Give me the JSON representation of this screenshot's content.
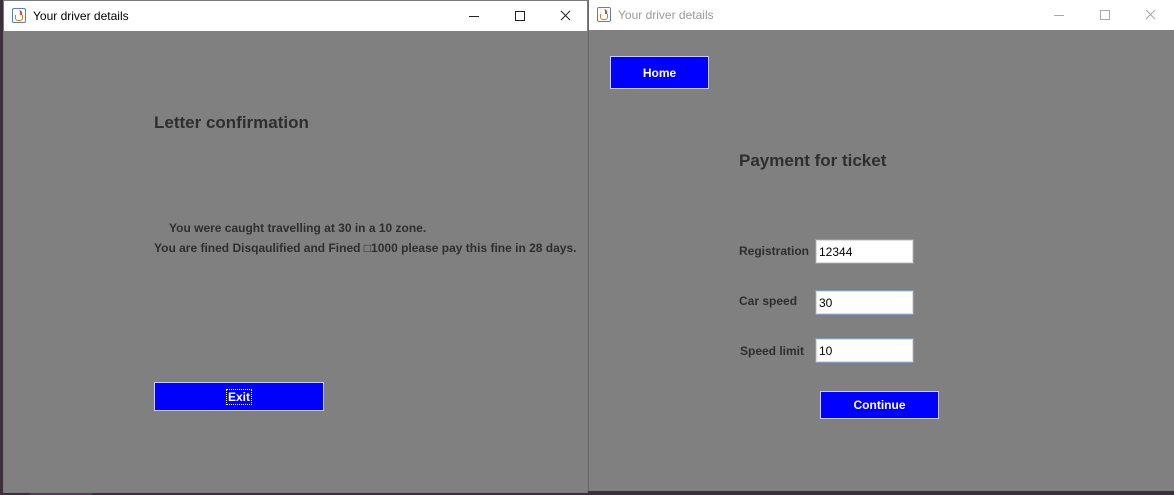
{
  "left_window": {
    "title": "Your driver details",
    "heading": "Letter confirmation",
    "message_line1": "You were caught travelling at 30 in a 10 zone.",
    "message_line2": "You are fined Disqaulified and Fined □1000 please pay this fine in 28 days.",
    "exit_label": "Exit"
  },
  "right_window": {
    "title": "Your driver details",
    "home_label": "Home",
    "heading": "Payment for ticket",
    "fields": [
      {
        "label": "Registration",
        "value": "12344"
      },
      {
        "label": "Car speed",
        "value": "30"
      },
      {
        "label": "Speed limit",
        "value": "10"
      }
    ],
    "continue_label": "Continue"
  },
  "colors": {
    "window_bg": "#808080",
    "button_bg": "#0000ff",
    "button_text": "#ffffff",
    "text": "#2e2e2e"
  }
}
